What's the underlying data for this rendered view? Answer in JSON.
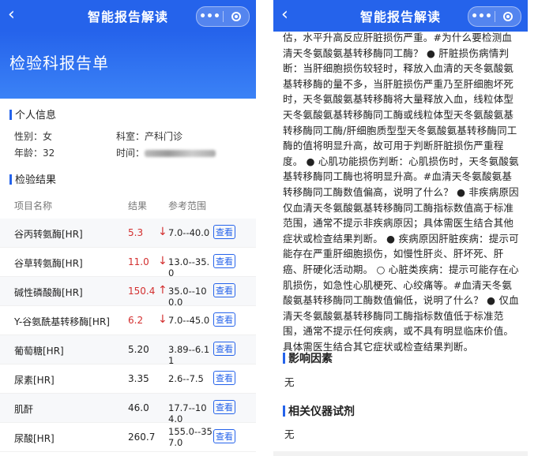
{
  "left": {
    "nav_title": "智能报告解读",
    "header_title": "检验科报告单",
    "personal_section": "个人信息",
    "gender_label": "性别：女",
    "dept_label": "科室：产科门诊",
    "age_label": "年龄：32",
    "time_label": "时间：",
    "results_section": "检验结果",
    "columns": [
      "项目名称",
      "结果",
      "参考范围"
    ],
    "rows": [
      {
        "name": "谷丙转氨酶[HR]",
        "value": "5.3",
        "flag": "↓",
        "range": "7.0--40.0",
        "action": "查看"
      },
      {
        "name": "谷草转氨酶[HR]",
        "value": "11.0",
        "flag": "↓",
        "range": "13.0--35.0",
        "action": "查看"
      },
      {
        "name": "碱性磷酸酶[HR]",
        "value": "150.4",
        "flag": "↑",
        "range": "35.0--100.0",
        "action": "查看"
      },
      {
        "name": "Y-谷氨酰基转移酶[HR]",
        "value": "6.2",
        "flag": "↓",
        "range": "7.0--45.0",
        "action": "查看"
      },
      {
        "name": "葡萄糖[HR]",
        "value": "5.20",
        "flag": "",
        "range": "3.89--6.11",
        "action": "查看"
      },
      {
        "name": "尿素[HR]",
        "value": "3.35",
        "flag": "",
        "range": "2.6--7.5",
        "action": "查看"
      },
      {
        "name": "肌酐",
        "value": "46.0",
        "flag": "",
        "range": "17.7--104.0",
        "action": "查看"
      },
      {
        "name": "尿酸[HR]",
        "value": "260.7",
        "flag": "",
        "range": "155.0--357.0",
        "action": "查看"
      }
    ]
  },
  "right": {
    "nav_title": "智能报告解读",
    "body_text": "估，水平升高反应肝脏损伤严重。#为什么要检测血清天冬氨酸氨基转移酶同工酶？ ● 肝脏损伤病情判断：当肝细胞损伤较轻时，释放入血清的天冬氨酸氨基转移酶的量不多，当肝脏损伤严重乃至肝细胞坏死时，天冬氨酸氨基转移酶将大量释放入血，线粒体型天冬氨酸氨基转移酶同工酶或线粒体型天冬氨酸氨基转移酶同工酶/肝细胞质型型天冬氨酸氨基转移酶同工酶的值将明显升高，故可用于判断肝脏损伤严重程度。 ● 心肌功能损伤判断：心肌损伤时，天冬氨酸氨基转移酶同工酶也将明显升高。#血清天冬氨酸氨基转移酶同工酶数值偏高，说明了什么？ ● 非疾病原因仅血清天冬氨酸氨基转移酶同工酶指标数值高于标准范围，通常不提示非疾病原因；具体需医生结合其他症状或检查结果判断。 ● 疾病原因肝脏疾病：提示可能存在严重肝细胞损伤，如慢性肝炎、肝坏死、肝癌、肝硬化活动期。 ○ 心脏类疾病：提示可能存在心肌损伤，如急性心肌梗死、心绞痛等。#血清天冬氨酸氨基转移酶同工酶数值偏低，说明了什么？ ● 仅血清天冬氨酸氨基转移酶同工酶指标数值低于标准范围，通常不提示任何疾病，或不具有明显临床价值。具体需医生结合其它症状或检查结果判断。",
    "factors_title": "影响因素",
    "factors_value": "无",
    "instruments_title": "相关仪器试剂",
    "instruments_value": "无"
  },
  "colors": {
    "primary": "#2563eb",
    "abnormal": "#d32f2f"
  },
  "icons": {
    "back": "chevron-left-icon",
    "more": "more-dots-icon",
    "close": "record-target-icon"
  }
}
